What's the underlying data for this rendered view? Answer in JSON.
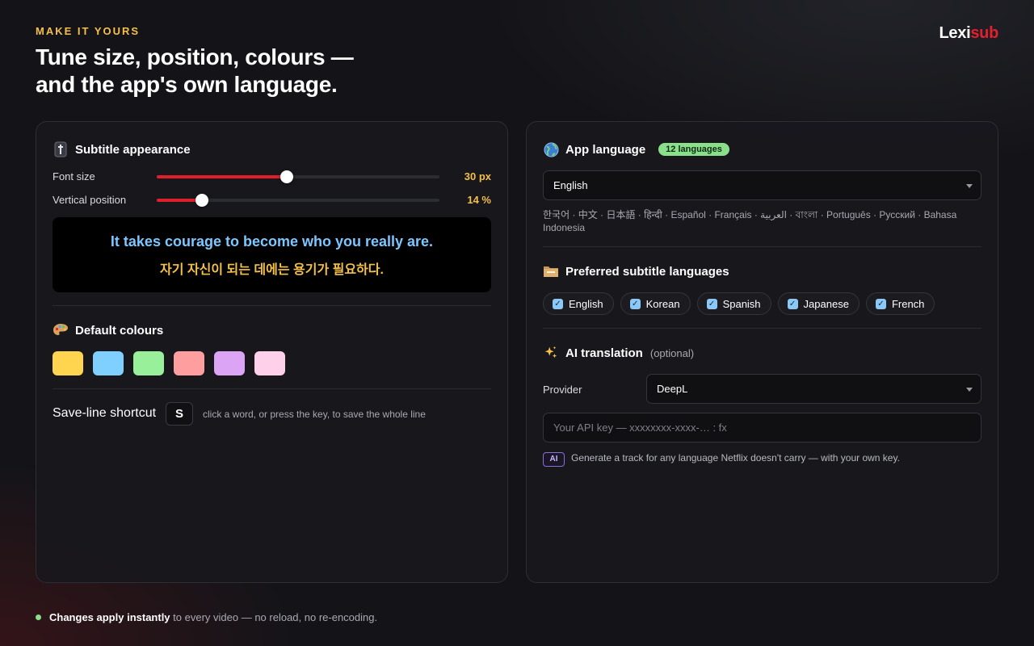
{
  "header": {
    "eyebrow": "MAKE IT YOURS",
    "title_line1": "Tune size, position, colours —",
    "title_line2": "and the app's own language.",
    "logo_part1": "Lexi",
    "logo_part2": "sub"
  },
  "appearance": {
    "title": "Subtitle appearance",
    "icon": "subtitle-bar-icon",
    "font_size_label": "Font size",
    "font_size_value": "30 px",
    "font_size_level": 0.46,
    "position_label": "Vertical position",
    "position_value": "14 %",
    "position_level": 0.16,
    "preview_en": "It takes courage to become who you really are.",
    "preview_ko": "자기 자신이 되는 데에는 용기가 필요하다."
  },
  "colours": {
    "title": "Default colours",
    "icon": "palette-icon",
    "swatches": [
      "#ffd54f",
      "#7fcfff",
      "#98f09a",
      "#ff9e9e",
      "#dba4f5",
      "#ffd0ea"
    ]
  },
  "shortcut": {
    "label": "Save-line shortcut",
    "key": "S",
    "hint": "click a word, or press the key, to save the whole line"
  },
  "app_language": {
    "title": "App language",
    "icon": "globe-icon",
    "badge": "12 languages",
    "selected": "English",
    "list": "한국어 · 中文 · 日本語 · हिन्दी · Español · Français · العربية · বাংলা · Português · Русский · Bahasa Indonesia"
  },
  "preferred": {
    "title": "Preferred subtitle languages",
    "icon": "folder-icon",
    "chips": [
      "English",
      "Korean",
      "Spanish",
      "Japanese",
      "French"
    ]
  },
  "ai": {
    "title": "AI translation",
    "optional": "(optional)",
    "icon": "sparkles-icon",
    "provider_label": "Provider",
    "provider_value": "DeepL",
    "api_placeholder": "Your API key — xxxxxxxx-xxxx-… : fx",
    "badge": "AI",
    "hint": "Generate a track for any language Netflix doesn't carry — with your own key."
  },
  "footer": {
    "bold": "Changes apply instantly",
    "rest": "to every video — no reload, no re-encoding."
  }
}
